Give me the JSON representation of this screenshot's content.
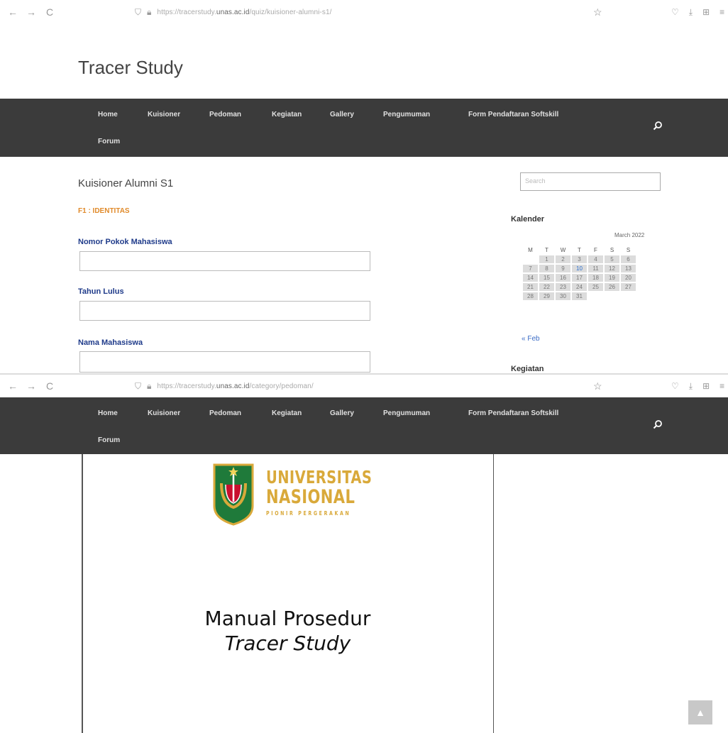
{
  "browser_top": {
    "back": "←",
    "forward": "→",
    "reload": "C",
    "url_prefix": "https://tracerstudy.",
    "url_domain": "unas.ac.id",
    "url_path": "/quiz/kuisioner-alumni-s1/",
    "star": "☆",
    "right_icons": [
      "♡",
      "⤓",
      "⊞",
      "≡"
    ]
  },
  "browser_bottom": {
    "back": "←",
    "forward": "→",
    "reload": "C",
    "url_prefix": "https://tracerstudy.",
    "url_domain": "unas.ac.id",
    "url_path": "/category/pedoman/",
    "star": "☆",
    "right_icons": [
      "♡",
      "⤓",
      "⊞",
      "≡"
    ]
  },
  "site": {
    "title": "Tracer Study"
  },
  "nav": {
    "items": [
      "Home",
      "Kuisioner",
      "Pedoman",
      "Kegiatan",
      "Gallery",
      "Pengumuman",
      "Form Pendaftaran Softskill"
    ],
    "forum": "Forum",
    "search_icon": "magnifier-icon"
  },
  "main": {
    "heading": "Kuisioner Alumni S1",
    "section": "F1 : IDENTITAS",
    "fields": [
      {
        "label": "Nomor Pokok Mahasiswa",
        "value": ""
      },
      {
        "label": "Tahun Lulus",
        "value": ""
      },
      {
        "label": "Nama Mahasiswa",
        "value": ""
      }
    ]
  },
  "sidebar": {
    "search_placeholder": "Search",
    "calendar_title": "Kalender",
    "calendar_month": "March 2022",
    "weekdays": [
      "M",
      "T",
      "W",
      "T",
      "F",
      "S",
      "S"
    ],
    "weeks": [
      [
        "",
        "1",
        "2",
        "3",
        "4",
        "5",
        "6"
      ],
      [
        "7",
        "8",
        "9",
        "10",
        "11",
        "12",
        "13"
      ],
      [
        "14",
        "15",
        "16",
        "17",
        "18",
        "19",
        "20"
      ],
      [
        "21",
        "22",
        "23",
        "24",
        "25",
        "26",
        "27"
      ],
      [
        "28",
        "29",
        "30",
        "31",
        "",
        "",
        ""
      ]
    ],
    "today": "10",
    "prev_link": "« Feb",
    "kegiatan_title": "Kegiatan"
  },
  "document": {
    "logo_line1": "UNIVERSITAS",
    "logo_line2": "NASIONAL",
    "logo_line3": "PIONIR PERGERAKAN",
    "title_line1": "Manual Prosedur",
    "title_line2": "Tracer Study"
  },
  "scroll_top_icon": "chevron-up-icon",
  "colors": {
    "nav_bg": "#3b3b3b",
    "section_label": "#e08a2a",
    "field_label": "#1f3b8a",
    "logo_gold": "#d9a93a",
    "logo_green": "#1f7a3a"
  }
}
